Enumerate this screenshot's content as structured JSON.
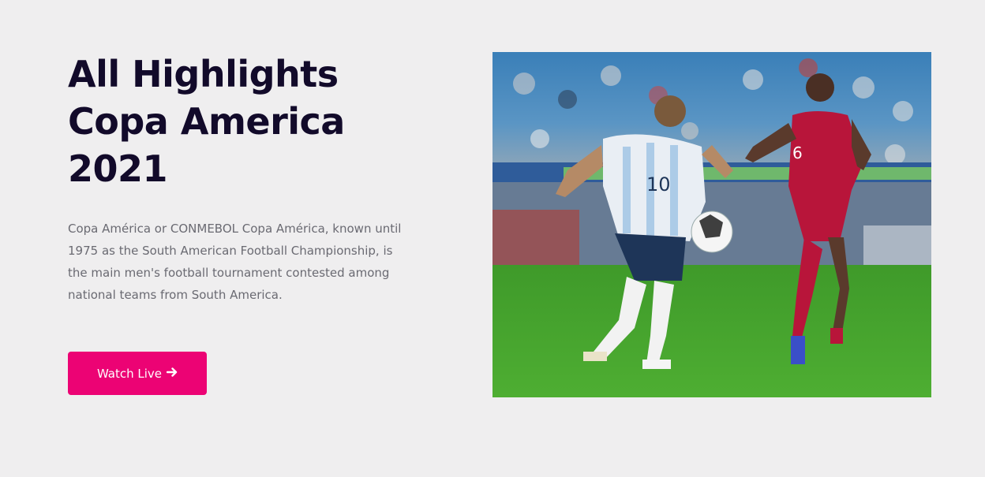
{
  "hero": {
    "title_lines": [
      "All Highlights",
      "Copa America",
      "2021"
    ],
    "description": "Copa América or CONMEBOL Copa América, known until 1975 as the South American Football Championship, is the main men's football tournament contested among national teams from South America.",
    "cta_label": "Watch Live",
    "cta_icon": "arrow-right-icon",
    "image": {
      "left_player_number": "10",
      "right_player_number": "6"
    }
  },
  "colors": {
    "background": "#efeeef",
    "title": "#120a2a",
    "body_text": "#6a6a72",
    "accent": "#ec0374"
  }
}
